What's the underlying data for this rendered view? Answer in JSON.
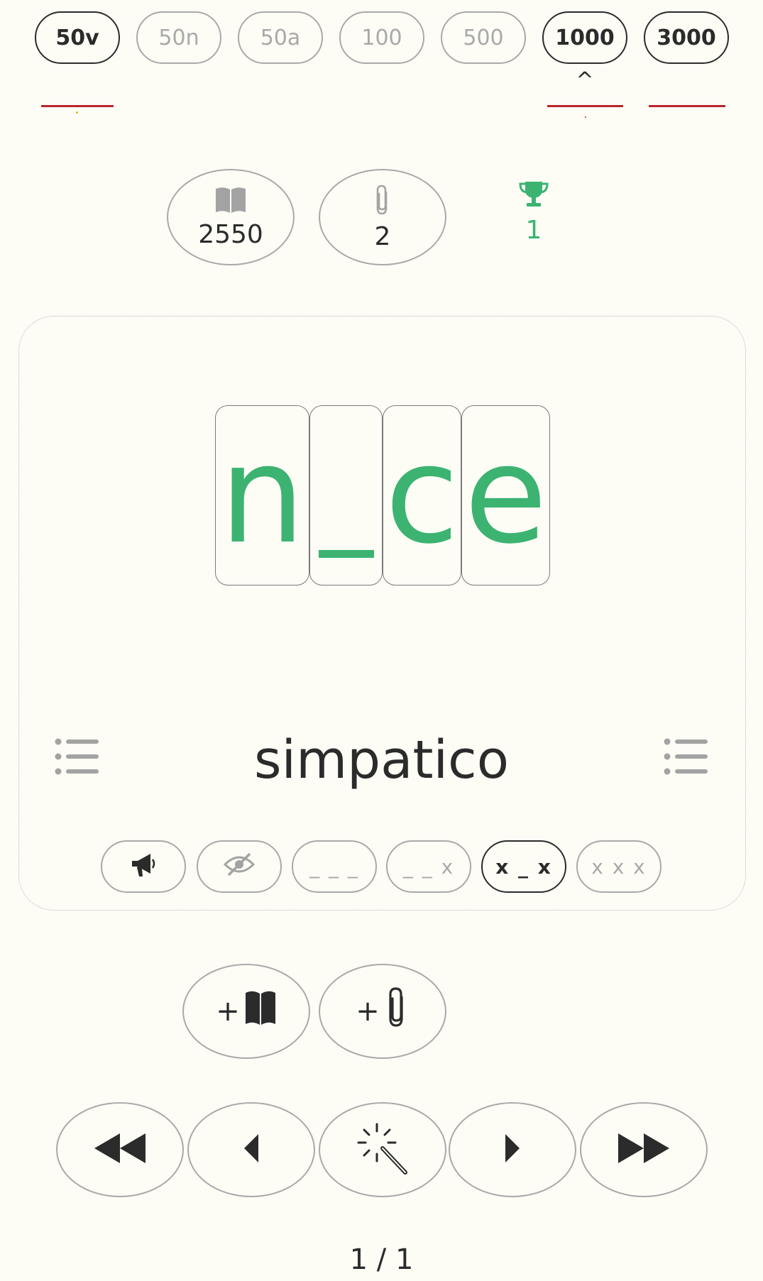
{
  "levels": [
    {
      "label": "50v",
      "active": true
    },
    {
      "label": "50n",
      "active": false
    },
    {
      "label": "50a",
      "active": false
    },
    {
      "label": "100",
      "active": false
    },
    {
      "label": "500",
      "active": false
    },
    {
      "label": "1000",
      "active": true
    },
    {
      "label": "3000",
      "active": true
    }
  ],
  "level_marker": "^",
  "stats": {
    "book_count": "2550",
    "clip_count": "2",
    "trophy_count": "1"
  },
  "puzzle": {
    "tiles": [
      "n",
      "_",
      "c",
      "e"
    ],
    "answer_word": "simpatico"
  },
  "modes": [
    {
      "icon": "megaphone-icon",
      "label": "",
      "active": false
    },
    {
      "icon": "eye-slash-icon",
      "label": "",
      "active": false
    },
    {
      "icon": "",
      "label": "_ _ _",
      "active": false
    },
    {
      "icon": "",
      "label": "_ _ x",
      "active": false
    },
    {
      "icon": "",
      "label": "x _ x",
      "active": true
    },
    {
      "icon": "",
      "label": "x x x",
      "active": false
    }
  ],
  "actions": {
    "add_book_label": "+",
    "add_clip_label": "+"
  },
  "pager": "1 / 1",
  "colors": {
    "accent": "#3cb371",
    "underline": "#b8252b",
    "border": "#a9a9a9",
    "text": "#2b2b2b",
    "background": "#fdfdf6"
  }
}
